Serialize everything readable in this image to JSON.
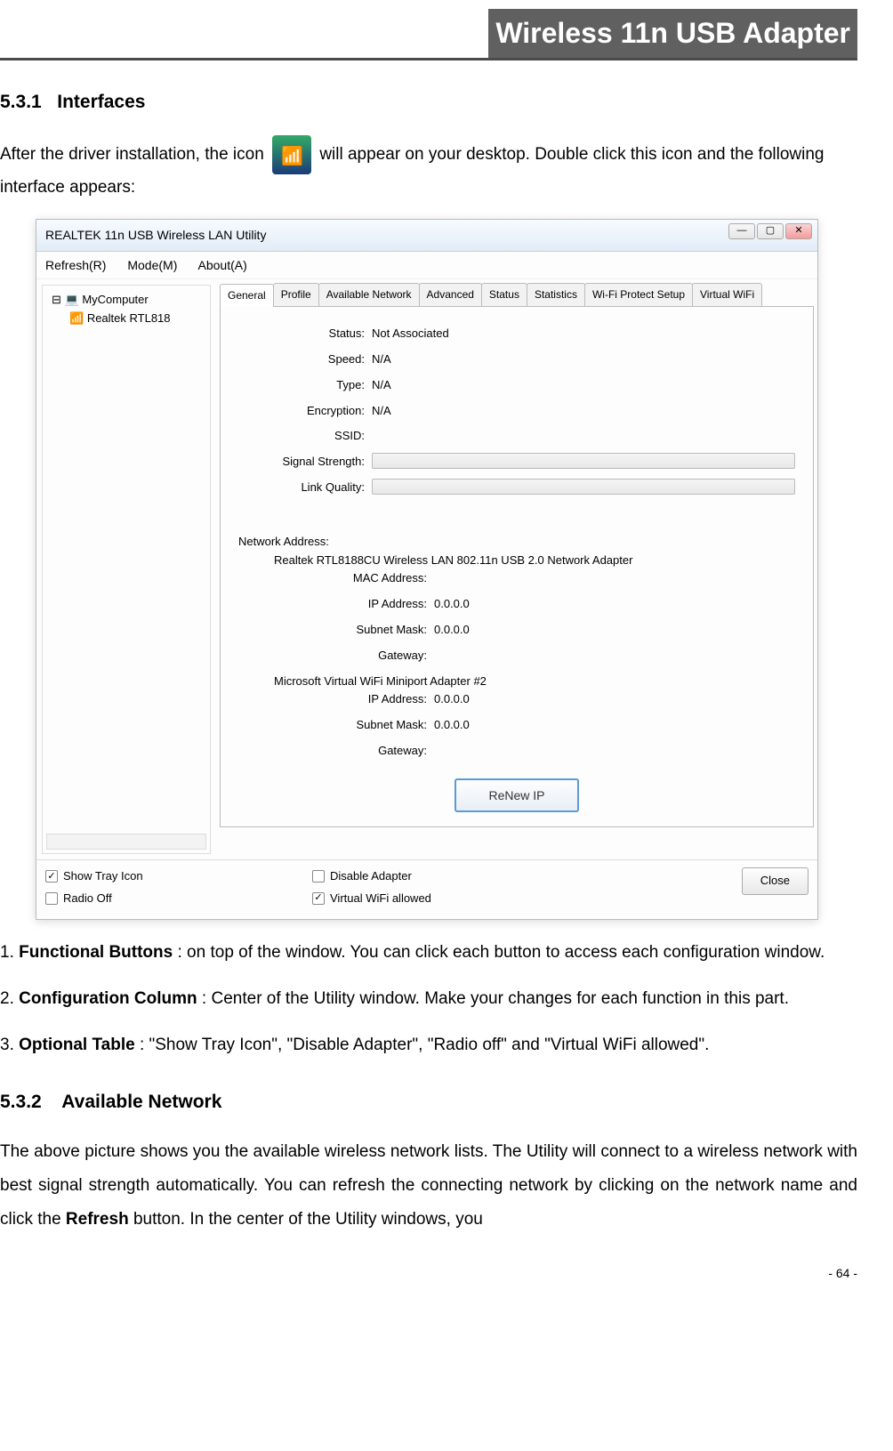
{
  "header": {
    "title": "Wireless 11n USB Adapter"
  },
  "section1": {
    "num": "5.3.1",
    "title": "Interfaces"
  },
  "intro": {
    "p1a": "After the driver installation, the icon ",
    "p1b": " will appear on your desktop. Double click this icon and the following interface appears:"
  },
  "window": {
    "title": "REALTEK 11n USB Wireless LAN Utility",
    "menu": [
      "Refresh(R)",
      "Mode(M)",
      "About(A)"
    ],
    "win_ctrls": {
      "min": "—",
      "max": "▢",
      "close": "✕"
    },
    "tree": {
      "root": "MyComputer",
      "child": "Realtek RTL818"
    },
    "tabs": [
      "General",
      "Profile",
      "Available Network",
      "Advanced",
      "Status",
      "Statistics",
      "Wi-Fi Protect Setup",
      "Virtual WiFi"
    ],
    "fields": {
      "status_l": "Status:",
      "status_v": "Not Associated",
      "speed_l": "Speed:",
      "speed_v": "N/A",
      "type_l": "Type:",
      "type_v": "N/A",
      "enc_l": "Encryption:",
      "enc_v": "N/A",
      "ssid_l": "SSID:",
      "ssid_v": "",
      "sig_l": "Signal Strength:",
      "lq_l": "Link Quality:"
    },
    "addr": {
      "heading": "Network Address:",
      "adapter1": "Realtek RTL8188CU Wireless LAN 802.11n USB 2.0 Network Adapter",
      "mac_l": "MAC Address:",
      "mac_v": "",
      "ip_l": "IP Address:",
      "ip_v": "0.0.0.0",
      "mask_l": "Subnet Mask:",
      "mask_v": "0.0.0.0",
      "gw_l": "Gateway:",
      "gw_v": "",
      "adapter2": "Microsoft Virtual WiFi Miniport Adapter #2",
      "ip2_l": "IP Address:",
      "ip2_v": "0.0.0.0",
      "mask2_l": "Subnet Mask:",
      "mask2_v": "0.0.0.0",
      "gw2_l": "Gateway:",
      "gw2_v": ""
    },
    "renew": "ReNew IP",
    "bottom": {
      "show_tray": "Show Tray Icon",
      "radio_off": "Radio Off",
      "disable_adapter": "Disable Adapter",
      "virtual_wifi": "Virtual WiFi allowed",
      "close": "Close"
    },
    "checks": {
      "show_tray": "✓",
      "virtual_wifi": "✓"
    }
  },
  "list": {
    "i1_num": "1. ",
    "i1_bold": "Functional Buttons",
    "i1_rest": " : on top of the window. You can click each button to access each configuration window.",
    "i2_num": "2. ",
    "i2_bold": "Configuration Column",
    "i2_rest": " : Center of the Utility window. Make your changes for each function in this part.",
    "i3_num": "3. ",
    "i3_bold": "Optional Table",
    "i3_rest": " : \"Show Tray Icon\", \"Disable Adapter\", \"Radio off\" and \"Virtual WiFi allowed\"."
  },
  "section2": {
    "num": "5.3.2",
    "title": "Available Network"
  },
  "para2": "The above picture shows you the available wireless network lists. The Utility will connect to a wireless network with best signal strength automatically. You can refresh the connecting network by clicking on the network name and click the ",
  "para2bold": "Refresh",
  "para2end": " button. In the center of the Utility windows, you",
  "pageno": "- 64 -"
}
